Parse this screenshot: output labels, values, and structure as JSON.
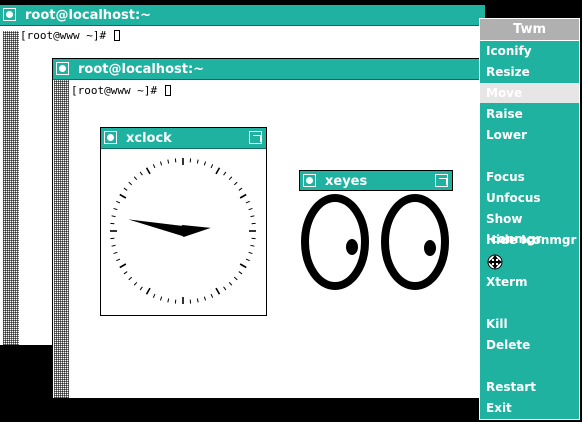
{
  "colors": {
    "title_bar": "#20b2a0",
    "menu_bg": "#20b2a0",
    "menu_title_bg": "#b0b0b0",
    "desktop": "#000000"
  },
  "xterm_back": {
    "title": "root@localhost:~",
    "prompt": "[root@www ~]# "
  },
  "xterm_front": {
    "title": "root@localhost:~",
    "prompt": "[root@www ~]# "
  },
  "xclock": {
    "title": "xclock",
    "time": {
      "hour": 2,
      "minute": 47
    }
  },
  "xeyes": {
    "title": "xeyes"
  },
  "twm_menu": {
    "title": "Twm",
    "items": [
      "Iconify",
      "Resize",
      "Move",
      "Raise",
      "Lower",
      "",
      "Focus",
      "Unfocus",
      "Show Iconmgr",
      "Hide Iconmgr",
      "move-cursor-icon",
      "Xterm",
      "",
      "Kill",
      "Delete",
      "",
      "Restart",
      "Exit"
    ],
    "selected": "Move"
  }
}
